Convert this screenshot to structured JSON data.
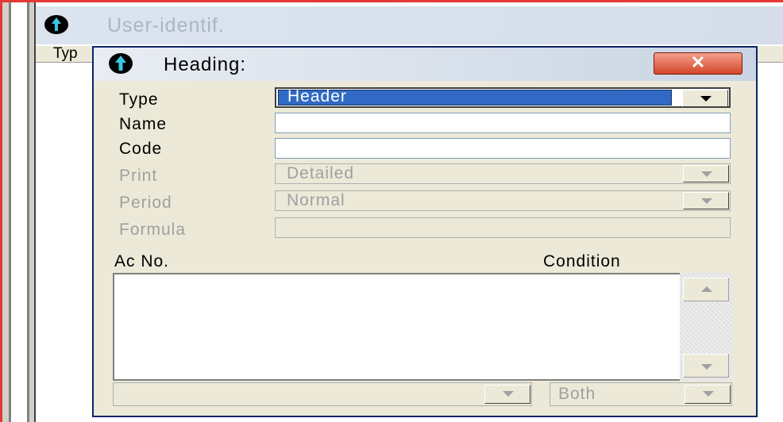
{
  "background_window": {
    "title": "User-identif.",
    "column_header": "Typ"
  },
  "dialog": {
    "title": "Heading:",
    "close_label": "✕",
    "fields": {
      "type": {
        "label": "Type",
        "value": "Header"
      },
      "name": {
        "label": "Name",
        "value": ""
      },
      "code": {
        "label": "Code",
        "value": ""
      },
      "print": {
        "label": "Print",
        "value": "Detailed"
      },
      "period": {
        "label": "Period",
        "value": "Normal"
      },
      "formula": {
        "label": "Formula",
        "value": ""
      }
    },
    "grid": {
      "col_left": "Ac No.",
      "col_right": "Condition"
    },
    "bottom": {
      "left_value": "",
      "right_value": "Both"
    }
  },
  "colors": {
    "accent": "#316ac5",
    "close": "#d5462c",
    "disabled_text": "#a0a0a0"
  }
}
